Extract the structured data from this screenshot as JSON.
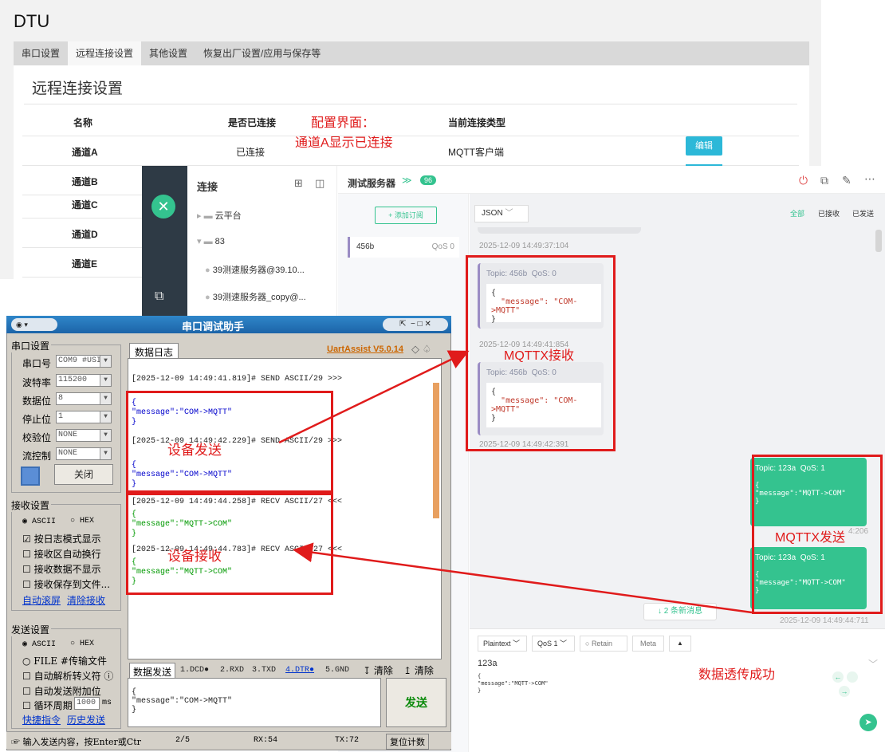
{
  "dtu": {
    "title": "DTU",
    "tabs": [
      "串口设置",
      "远程连接设置",
      "其他设置",
      "恢复出厂设置/应用与保存等"
    ],
    "section_title": "远程连接设置",
    "table_headers": [
      "名称",
      "是否已连接",
      "当前连接类型"
    ],
    "rows": [
      {
        "name": "通道A",
        "connected": "已连接",
        "type": "MQTT客户端"
      },
      {
        "name": "通道B"
      },
      {
        "name": "通道C"
      },
      {
        "name": "通道D"
      },
      {
        "name": "通道E"
      }
    ],
    "edit_label": "编辑"
  },
  "annotations": {
    "config_line1": "配置界面：",
    "config_line2": "通道A显示已连接",
    "mqttx_recv": "MQTTX接收",
    "mqttx_send": "MQTTX发送",
    "device_send": "设备发送",
    "device_recv": "设备接收",
    "success": "数据透传成功"
  },
  "mqttx": {
    "conn_title": "连接",
    "tree": [
      {
        "label": "云平台"
      },
      {
        "label": "83"
      },
      {
        "label": "39测速服务器@39.10..."
      },
      {
        "label": "39测速服务器_copy@..."
      }
    ],
    "server_name": "测试服务器",
    "server_badge": "96",
    "add_sub": "+ 添加订阅",
    "sub_topic": "456b",
    "sub_qos": "QoS 0",
    "format": "JSON",
    "filters": [
      "全部",
      "已接收",
      "已发送"
    ],
    "ts0": "2025-12-09 14:49:37:104",
    "incoming": [
      {
        "topic": "Topic: 456b",
        "qos": "QoS: 0",
        "message": "\"message\": \"COM->MQTT\"",
        "time": "2025-12-09 14:49:41:854"
      },
      {
        "topic": "Topic: 456b",
        "qos": "QoS: 0",
        "message": "\"message\": \"COM->MQTT\"",
        "time": "2025-12-09 14:49:42:391"
      }
    ],
    "outgoing": [
      {
        "topic": "Topic: 123a",
        "qos": "QoS: 1",
        "message": "\"message\":\"MQTT->COM\"",
        "time": "4:206"
      },
      {
        "topic": "Topic: 123a",
        "qos": "QoS: 1",
        "message": "\"message\":\"MQTT->COM\"",
        "time": "2025-12-09 14:49:44:711"
      }
    ],
    "new_msgs": "↓ 2 条新消息",
    "payload_type": "Plaintext",
    "qos_sel": "QoS 1",
    "retain": "Retain",
    "meta": "Meta",
    "publish_topic": "123a",
    "publish_body_l1": "{",
    "publish_body_l2": "\"message\":\"MQTT->COM\"",
    "publish_body_l3": "}"
  },
  "uart": {
    "title": "串口调试助手",
    "version": "UartAssist V5.0.14",
    "serial_group": "串口设置",
    "port_label": "串口号",
    "port_val": "COM9 #USI",
    "baud_label": "波特率",
    "baud_val": "115200",
    "data_label": "数据位",
    "data_val": "8",
    "stop_label": "停止位",
    "stop_val": "1",
    "parity_label": "校验位",
    "parity_val": "NONE",
    "flow_label": "流控制",
    "flow_val": "NONE",
    "close_btn": "关闭",
    "recv_group": "接收设置",
    "recv_ascii": "ASCII",
    "recv_hex": "HEX",
    "recv_opts": [
      "按日志模式显示",
      "接收区自动换行",
      "接收数据不显示",
      "接收保存到文件..."
    ],
    "recv_links": [
      "自动滚屏",
      "清除接收"
    ],
    "send_group": "发送设置",
    "send_ascii": "ASCII",
    "send_hex": "HEX",
    "send_opts": [
      "FILE #传输文件",
      "自动解析转义符 ⓘ",
      "自动发送附加位",
      "循环周期"
    ],
    "cycle_val": "1000",
    "cycle_unit": "ms",
    "send_links": [
      "快捷指令",
      "历史发送"
    ],
    "log_tab": "数据日志",
    "log": [
      {
        "head": "[2025-12-09 14:49:41.819]# SEND ASCII/29 >>>",
        "open": "{",
        "body": "\"message\":\"COM->MQTT\"",
        "close": "}"
      },
      {
        "head": "[2025-12-09 14:49:42.229]# SEND ASCII/29 >>>",
        "open": "{",
        "body": "\"message\":\"COM->MQTT\"",
        "close": "}"
      },
      {
        "head": "[2025-12-09 14:49:44.258]# RECV ASCII/27 <<<",
        "open": "{",
        "body": "\"message\":\"MQTT->COM\"",
        "close": "}"
      },
      {
        "head": "[2025-12-09 14:49:44.783]# RECV ASCII/27 <<<",
        "open": "{",
        "body": "\"message\":\"MQTT->COM\"",
        "close": "}"
      }
    ],
    "send_tab": "数据发送",
    "pins": [
      "1.DCD●",
      "2.RXD",
      "3.TXD",
      "4.DTR●",
      "5.GND"
    ],
    "clear1": "清除",
    "clear2": "清除",
    "send_l1": "{",
    "send_l2": "\"message\":\"COM->MQTT\"",
    "send_l3": "}",
    "send_btn": "发送",
    "status_hint": "输入发送内容，按Enter或Ctr",
    "status_page": "2/5",
    "status_rx": "RX:54",
    "status_tx": "TX:72",
    "status_reset": "复位计数"
  },
  "colors": {
    "accent_red": "#e01b1b",
    "mqttx_green": "#34c38f",
    "edit_blue": "#2cb8d8"
  }
}
